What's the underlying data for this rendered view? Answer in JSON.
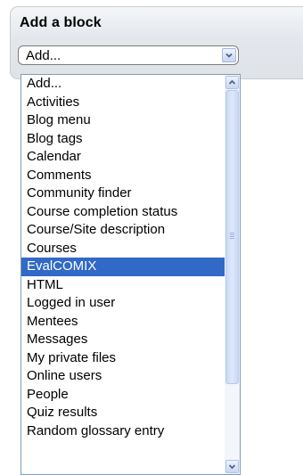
{
  "block": {
    "title": "Add a block"
  },
  "select": {
    "value": "Add..."
  },
  "dropdown": {
    "options": [
      "Add...",
      "Activities",
      "Blog menu",
      "Blog tags",
      "Calendar",
      "Comments",
      "Community finder",
      "Course completion status",
      "Course/Site description",
      "Courses",
      "EvalCOMIX",
      "HTML",
      "Logged in user",
      "Mentees",
      "Messages",
      "My private files",
      "Online users",
      "People",
      "Quiz results",
      "Random glossary entry"
    ],
    "highlighted": "EvalCOMIX"
  },
  "icons": {
    "select_arrow": "chevron-down-icon",
    "scroll_up": "chevron-up-icon",
    "scroll_down": "chevron-down-icon"
  },
  "colors": {
    "highlight_bg": "#3169c6",
    "highlight_text": "#ffffff",
    "dropdown_border": "#7f9db9",
    "panel_bg": "#e3e7ec"
  }
}
